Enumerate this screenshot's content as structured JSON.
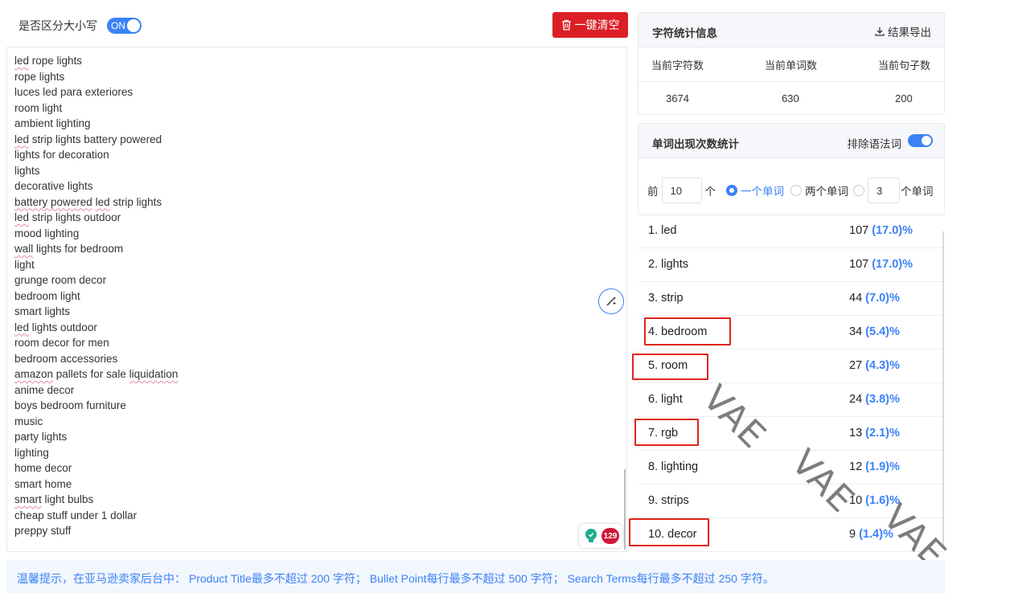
{
  "toolbar": {
    "case_sensitive_label": "是否区分大小写",
    "case_toggle_text": "ON",
    "clear_button_label": "一键清空"
  },
  "editor": {
    "lines": [
      {
        "parts": [
          {
            "t": "led",
            "sq": true
          },
          {
            "t": " rope lights"
          }
        ]
      },
      {
        "parts": [
          {
            "t": "rope lights"
          }
        ]
      },
      {
        "parts": [
          {
            "t": "luces led para exteriores"
          }
        ]
      },
      {
        "parts": [
          {
            "t": "room light"
          }
        ]
      },
      {
        "parts": [
          {
            "t": "ambient lighting"
          }
        ]
      },
      {
        "parts": [
          {
            "t": "led",
            "sq": true
          },
          {
            "t": " strip lights battery powered"
          }
        ]
      },
      {
        "parts": [
          {
            "t": "lights for decoration"
          }
        ]
      },
      {
        "parts": [
          {
            "t": "lights"
          }
        ]
      },
      {
        "parts": [
          {
            "t": "decorative lights"
          }
        ]
      },
      {
        "parts": [
          {
            "t": "battery powered",
            "sq": true
          },
          {
            "t": " "
          },
          {
            "t": "led",
            "sq": true
          },
          {
            "t": " strip lights"
          }
        ]
      },
      {
        "parts": [
          {
            "t": "led",
            "sq": true
          },
          {
            "t": " strip lights outdoor"
          }
        ]
      },
      {
        "parts": [
          {
            "t": "mood lighting"
          }
        ]
      },
      {
        "parts": [
          {
            "t": "wall",
            "sq": true
          },
          {
            "t": " lights for bedroom"
          }
        ]
      },
      {
        "parts": [
          {
            "t": "light"
          }
        ]
      },
      {
        "parts": [
          {
            "t": "grunge room decor"
          }
        ]
      },
      {
        "parts": [
          {
            "t": "bedroom light"
          }
        ]
      },
      {
        "parts": [
          {
            "t": "smart lights"
          }
        ]
      },
      {
        "parts": [
          {
            "t": "led",
            "sq": true
          },
          {
            "t": " lights outdoor"
          }
        ]
      },
      {
        "parts": [
          {
            "t": "room decor for men"
          }
        ]
      },
      {
        "parts": [
          {
            "t": "bedroom accessories"
          }
        ]
      },
      {
        "parts": [
          {
            "t": "amazon",
            "sq": true
          },
          {
            "t": " pallets for sale "
          },
          {
            "t": "liquidation",
            "sq": true
          }
        ]
      },
      {
        "parts": [
          {
            "t": "anime decor"
          }
        ]
      },
      {
        "parts": [
          {
            "t": "boys bedroom furniture"
          }
        ]
      },
      {
        "parts": [
          {
            "t": "music"
          }
        ]
      },
      {
        "parts": [
          {
            "t": "party lights"
          }
        ]
      },
      {
        "parts": [
          {
            "t": "lighting"
          }
        ]
      },
      {
        "parts": [
          {
            "t": "home decor"
          }
        ]
      },
      {
        "parts": [
          {
            "t": "smart home"
          }
        ]
      },
      {
        "parts": [
          {
            "t": "smart",
            "sq": true
          },
          {
            "t": " light bulbs"
          }
        ]
      },
      {
        "parts": [
          {
            "t": "cheap stuff under 1 dollar"
          }
        ]
      },
      {
        "parts": [
          {
            "t": "preppy stuff"
          }
        ]
      }
    ],
    "grammar_badge_count": "129"
  },
  "char_stats": {
    "title": "字符统计信息",
    "export_label": "结果导出",
    "headers": [
      "当前字符数",
      "当前单词数",
      "当前句子数"
    ],
    "values": [
      "3674",
      "630",
      "200"
    ]
  },
  "word_stats": {
    "title": "单词出现次数统计",
    "exclude_grammar_label": "排除语法词",
    "top_prefix": "前",
    "top_value": "10",
    "top_suffix": "个",
    "option_one": "一个单词",
    "option_two": "两个单词",
    "option_n_value": "3",
    "option_n_suffix": "个单词",
    "selected_option": "one",
    "rows": [
      {
        "term": "1. led",
        "count": "107",
        "pct": "(17.0)",
        "suffix": "%"
      },
      {
        "term": "2. lights",
        "count": "107",
        "pct": "(17.0)",
        "suffix": "%"
      },
      {
        "term": "3. strip",
        "count": "44",
        "pct": "(7.0)",
        "suffix": "%"
      },
      {
        "term": "4. bedroom",
        "count": "34",
        "pct": "(5.4)",
        "suffix": "%"
      },
      {
        "term": "5. room",
        "count": "27",
        "pct": "(4.3)",
        "suffix": "%"
      },
      {
        "term": "6. light",
        "count": "24",
        "pct": "(3.8)",
        "suffix": "%"
      },
      {
        "term": "7. rgb",
        "count": "13",
        "pct": "(2.1)",
        "suffix": "%"
      },
      {
        "term": "8. lighting",
        "count": "12",
        "pct": "(1.9)",
        "suffix": "%"
      },
      {
        "term": "9. strips",
        "count": "10",
        "pct": "(1.6)",
        "suffix": "%"
      },
      {
        "term": "10. decor",
        "count": "9",
        "pct": "(1.4)",
        "suffix": "%"
      }
    ]
  },
  "watermark": [
    "VAE",
    "VAE",
    "VAE"
  ],
  "footer": {
    "tip": "温馨提示，在亚马逊卖家后台中： Product Title最多不超过 200 字符； Bullet Point每行最多不超过 500 字符； Search Terms每行最多不超过 250 字符。"
  },
  "colors": {
    "accent": "#3b82f6",
    "danger": "#dc1f26",
    "highlight_box": "#e0241b"
  }
}
